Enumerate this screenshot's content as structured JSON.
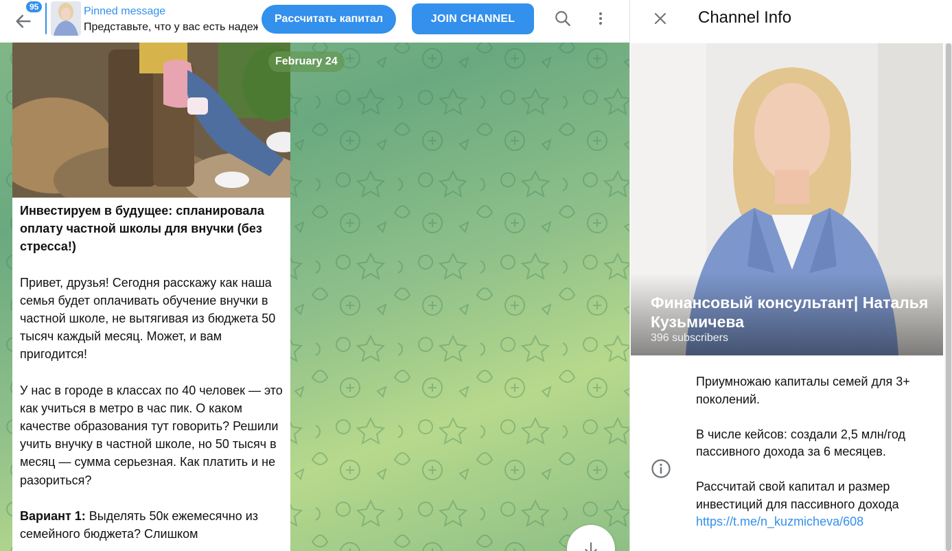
{
  "header": {
    "unread_count": "95",
    "pinned_title": "Pinned message",
    "pinned_text": "Представьте, что у вас есть надеж...",
    "calc_button": "Рассчитать капитал",
    "join_button": "JOIN CHANNEL"
  },
  "chat": {
    "date": "February 24",
    "message": {
      "headline": "Инвестируем в будущее: спланировала оплату частной школы для внучки (без стресса!)",
      "para1": "Привет, друзья! Сегодня расскажу как наша семья будет оплачивать обучение внучки в частной школе, не вытягивая из бюджета 50 тысяч каждый месяц. Может, и вам пригодится!",
      "para2": "У нас в городе в классах по 40 человек — это как учиться в метро в час пик. О каком качестве образования тут говорить? Решили учить внучку в частной школе, но 50 тысяч в месяц — сумма серьезная. Как платить и не разориться?",
      "variant_label": "Вариант 1:",
      "variant_text": " Выделять 50к ежемесячно из семейного бюджета? Слишком"
    }
  },
  "info": {
    "title": "Channel Info",
    "channel_name": "Финансовый консультант| Наталья Кузьмичева",
    "subscribers": "396 subscribers",
    "desc1": "Приумножаю капиталы семей для 3+ поколений.",
    "desc2": "В числе кейсов: создали 2,5 млн/год пассивного дохода за 6 месяцев.",
    "desc3": "Рассчитай свой капитал и размер инвестиций для пассивного дохода",
    "desc_link": "https://t.me/n_kuzmicheva/608"
  },
  "colors": {
    "accent": "#3390ec"
  },
  "icons": [
    "back-arrow-icon",
    "search-icon",
    "more-vertical-icon",
    "close-icon",
    "info-icon",
    "arrow-down-icon"
  ]
}
